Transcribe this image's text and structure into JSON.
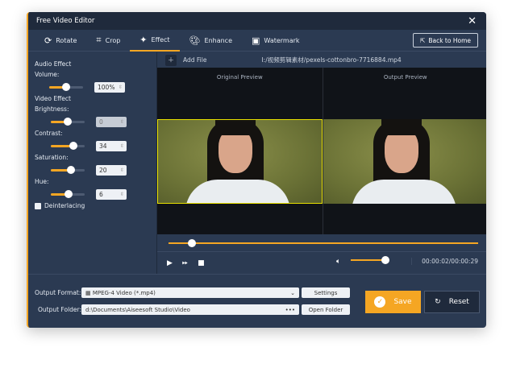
{
  "window": {
    "title": "Free Video Editor",
    "close_icon": "close-icon"
  },
  "tabs": [
    {
      "label": "Rotate",
      "icon": "rotate-icon"
    },
    {
      "label": "Crop",
      "icon": "crop-icon"
    },
    {
      "label": "Effect",
      "icon": "effect-icon",
      "active": true
    },
    {
      "label": "Enhance",
      "icon": "palette-icon"
    },
    {
      "label": "Watermark",
      "icon": "watermark-icon"
    }
  ],
  "back_home": "Back to Home",
  "left": {
    "audio_effect": "Audio Effect",
    "volume": {
      "label": "Volume:",
      "value": "100%",
      "level": 0.5
    },
    "video_effect": "Video Effect",
    "brightness": {
      "label": "Brightness:",
      "value": "0",
      "level": 0.5
    },
    "contrast": {
      "label": "Contrast:",
      "value": "34",
      "level": 0.67
    },
    "saturation": {
      "label": "Saturation:",
      "value": "20",
      "level": 0.6
    },
    "hue": {
      "label": "Hue:",
      "value": "6",
      "level": 0.53
    },
    "deinterlacing": {
      "label": "Deinterlacing",
      "checked": false
    }
  },
  "file": {
    "add_label": "Add File",
    "path": "I:/视频剪辑素材/pexels-cottonbro-7716884.mp4"
  },
  "preview": {
    "original": "Original Preview",
    "output": "Output Preview"
  },
  "player": {
    "progress": 0.07,
    "volume": 0.85,
    "time": "00:00:02/00:00:29"
  },
  "output": {
    "format_label": "Output Format:",
    "format_value": "MPEG-4 Video (*.mp4)",
    "settings": "Settings",
    "folder_label": "Output Folder:",
    "folder_value": "d:\\Documents\\Aiseesoft Studio\\Video",
    "folder_more": "•••",
    "open_folder": "Open Folder"
  },
  "actions": {
    "save": "Save",
    "reset": "Reset"
  },
  "colors": {
    "accent": "#f5a623",
    "bg": "#2b3a52"
  }
}
